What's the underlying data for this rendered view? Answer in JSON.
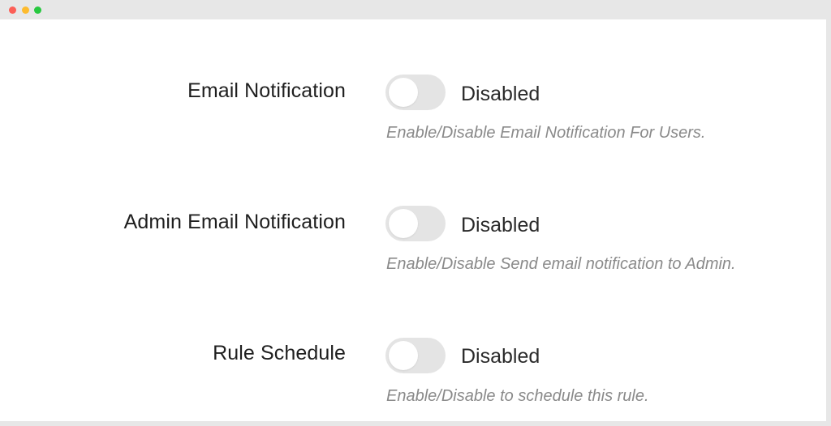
{
  "window": {
    "controls": [
      "close",
      "minimize",
      "maximize"
    ]
  },
  "settings": [
    {
      "label": "Email Notification",
      "enabled": false,
      "status": "Disabled",
      "help": "Enable/Disable Email Notification For Users."
    },
    {
      "label": "Admin Email Notification",
      "enabled": false,
      "status": "Disabled",
      "help": "Enable/Disable Send email notification to Admin."
    },
    {
      "label": "Rule Schedule",
      "enabled": false,
      "status": "Disabled",
      "help": "Enable/Disable to schedule this rule."
    }
  ]
}
